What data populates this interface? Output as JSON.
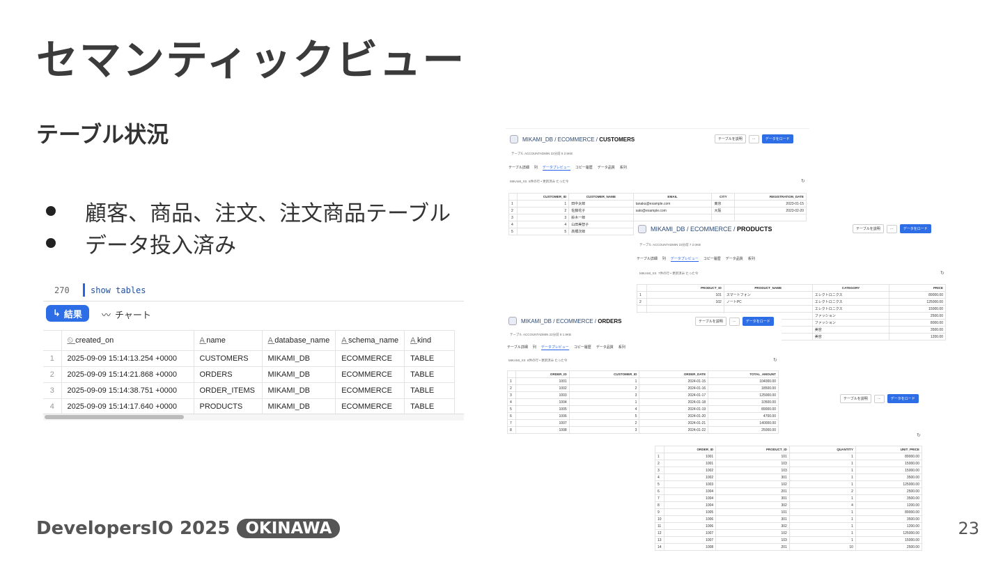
{
  "slide": {
    "title": "セマンティックビュー",
    "subtitle": "テーブル状況",
    "bullets": [
      "顧客、商品、注文、注文商品テーブル",
      "データ投入済み"
    ],
    "footer_logo": "DevelopersIO 2025",
    "footer_badge": "OKINAWA",
    "page_number": "23"
  },
  "sql_panel": {
    "line_number": "270",
    "code": "show tables",
    "results_tab": "結果",
    "chart_tab": "チャート",
    "columns": [
      "created_on",
      "name",
      "database_name",
      "schema_name",
      "kind"
    ],
    "rows": [
      {
        "idx": "1",
        "cells": [
          "2025-09-09 15:14:13.254 +0000",
          "CUSTOMERS",
          "MIKAMI_DB",
          "ECOMMERCE",
          "TABLE"
        ]
      },
      {
        "idx": "2",
        "cells": [
          "2025-09-09 15:14:21.868 +0000",
          "ORDERS",
          "MIKAMI_DB",
          "ECOMMERCE",
          "TABLE"
        ]
      },
      {
        "idx": "3",
        "cells": [
          "2025-09-09 15:14:38.751 +0000",
          "ORDER_ITEMS",
          "MIKAMI_DB",
          "ECOMMERCE",
          "TABLE"
        ]
      },
      {
        "idx": "4",
        "cells": [
          "2025-09-09 15:14:17.640 +0000",
          "PRODUCTS",
          "MIKAMI_DB",
          "ECOMMERCE",
          "TABLE"
        ]
      }
    ]
  },
  "common": {
    "describe_button": "テーブルを説明",
    "more_button": "···",
    "load_button": "データをロード",
    "tabs": [
      "テーブル詳細",
      "列",
      "データプレビュー",
      "コピー履歴",
      "データ品質",
      "系列"
    ],
    "preview_badge": "プレビュー",
    "warehouse": "MIKAMI_XS"
  },
  "customers": {
    "path_prefix": "MIKAMI_DB / ECOMMERCE /",
    "name": "CUSTOMERS",
    "meta": "テーブル  ACCOUNTADMIN  22分前  5  2.5KB",
    "rows_info": "5件の行 • 更新済み たった今",
    "columns": [
      "",
      "CUSTOMER_ID",
      "CUSTOMER_NAME",
      "EMAIL",
      "CITY",
      "REGISTRATION_DATE"
    ],
    "rows": [
      [
        "1",
        "1",
        "田中太郎",
        "tanaka@example.com",
        "東京",
        "2023-01-15"
      ],
      [
        "2",
        "2",
        "佐藤花子",
        "sato@example.com",
        "大阪",
        "2023-02-20"
      ],
      [
        "3",
        "3",
        "鈴木一郎",
        "",
        "",
        ""
      ],
      [
        "4",
        "4",
        "山田美智子",
        "",
        "",
        ""
      ],
      [
        "5",
        "5",
        "高橋次郎",
        "",
        "",
        ""
      ]
    ]
  },
  "products": {
    "path_prefix": "MIKAMI_DB / ECOMMERCE /",
    "name": "PRODUCTS",
    "meta": "テーブル  ACCOUNTADMIN  23分前  7  2.0KB",
    "rows_info": "7件の行 • 更新済み たった今",
    "columns": [
      "",
      "PRODUCT_ID",
      "PRODUCT_NAME",
      "CATEGORY",
      "PRICE"
    ],
    "rows": [
      [
        "1",
        "101",
        "スマートフォン",
        "エレクトロニクス",
        "89000.00"
      ],
      [
        "2",
        "102",
        "ノートPC",
        "エレクトロニクス",
        "125000.00"
      ],
      [
        "",
        "",
        "",
        "エレクトロニクス",
        "15000.00"
      ],
      [
        "",
        "",
        "",
        "ファッション",
        "2500.00"
      ],
      [
        "",
        "",
        "",
        "ファッション",
        "8000.00"
      ],
      [
        "",
        "",
        "",
        "美容",
        "3500.00"
      ],
      [
        "",
        "",
        "",
        "美容",
        "1200.00"
      ]
    ]
  },
  "orders": {
    "path_prefix": "MIKAMI_DB / ECOMMERCE /",
    "name": "ORDERS",
    "meta": "テーブル  ACCOUNTADMIN  22分前  8  1.9KB",
    "rows_info": "8件の行 • 更新済み たった今",
    "columns": [
      "",
      "ORDER_ID",
      "CUSTOMER_ID",
      "ORDER_DATE",
      "TOTAL_AMOUNT"
    ],
    "rows": [
      [
        "1",
        "1001",
        "1",
        "2024-01-15",
        "104000.00"
      ],
      [
        "2",
        "1002",
        "2",
        "2024-01-16",
        "18500.00"
      ],
      [
        "3",
        "1003",
        "3",
        "2024-01-17",
        "125000.00"
      ],
      [
        "4",
        "1004",
        "1",
        "2024-01-18",
        "10500.00"
      ],
      [
        "5",
        "1005",
        "4",
        "2024-01-19",
        "89000.00"
      ],
      [
        "6",
        "1006",
        "5",
        "2024-01-20",
        "4700.00"
      ],
      [
        "7",
        "1007",
        "2",
        "2024-01-21",
        "140000.00"
      ],
      [
        "8",
        "1008",
        "3",
        "2024-01-22",
        "25000.00"
      ]
    ]
  },
  "order_items": {
    "columns": [
      "",
      "ORDER_ID",
      "PRODUCT_ID",
      "QUANTITY",
      "UNIT_PRICE"
    ],
    "rows": [
      [
        "1",
        "1001",
        "101",
        "1",
        "89000.00"
      ],
      [
        "2",
        "1001",
        "103",
        "1",
        "15000.00"
      ],
      [
        "3",
        "1002",
        "103",
        "1",
        "15000.00"
      ],
      [
        "4",
        "1002",
        "301",
        "1",
        "3500.00"
      ],
      [
        "5",
        "1003",
        "102",
        "1",
        "125000.00"
      ],
      [
        "6",
        "1004",
        "201",
        "2",
        "2500.00"
      ],
      [
        "7",
        "1004",
        "301",
        "1",
        "3500.00"
      ],
      [
        "8",
        "1004",
        "302",
        "4",
        "1200.00"
      ],
      [
        "9",
        "1005",
        "101",
        "1",
        "89000.00"
      ],
      [
        "10",
        "1006",
        "301",
        "1",
        "3500.00"
      ],
      [
        "11",
        "1006",
        "302",
        "1",
        "1200.00"
      ],
      [
        "12",
        "1007",
        "102",
        "1",
        "125000.00"
      ],
      [
        "13",
        "1007",
        "103",
        "1",
        "15000.00"
      ],
      [
        "14",
        "1008",
        "201",
        "10",
        "2500.00"
      ]
    ]
  }
}
